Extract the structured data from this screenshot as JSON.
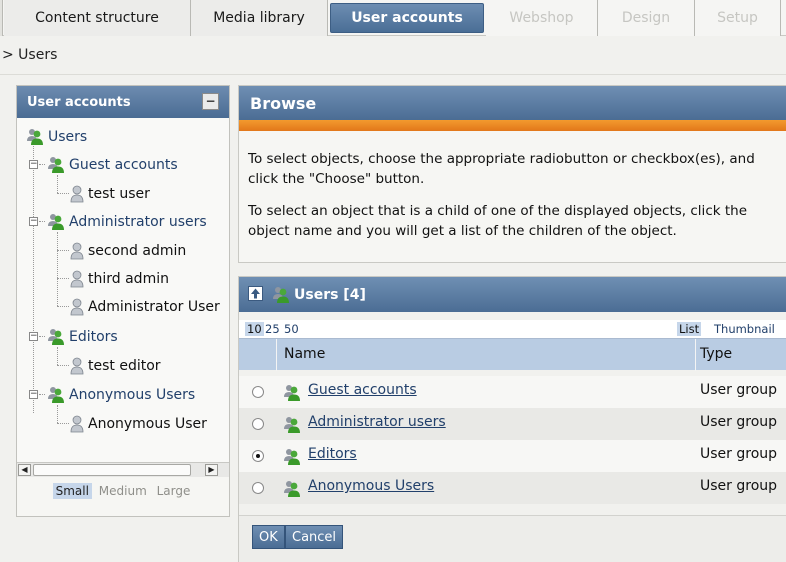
{
  "tabs": [
    {
      "label": "Content structure",
      "state": "normal"
    },
    {
      "label": "Media library",
      "state": "normal"
    },
    {
      "label": "User accounts",
      "state": "active"
    },
    {
      "label": "Webshop",
      "state": "disabled"
    },
    {
      "label": "Design",
      "state": "disabled"
    },
    {
      "label": "Setup",
      "state": "disabled"
    }
  ],
  "breadcrumb": "> Users",
  "left_panel": {
    "title": "User accounts",
    "minimize_label": "−",
    "tree": {
      "root": "Users",
      "guest_group": "Guest accounts",
      "test_user": "test user",
      "admin_group": "Administrator users",
      "second_admin": "second admin",
      "third_admin": "third admin",
      "administrator_user": "Administrator User",
      "editors_group": "Editors",
      "test_editor": "test editor",
      "anonymous_group": "Anonymous Users",
      "anonymous_user": "Anonymous User"
    },
    "sizes": {
      "small": "Small",
      "medium": "Medium",
      "large": "Large",
      "selected": "Small"
    }
  },
  "browse": {
    "title": "Browse",
    "paragraph1": "To select objects, choose the appropriate radiobutton or checkbox(es), and click the \"Choose\" button.",
    "paragraph2": "To select an object that is a child of one of the displayed objects, click the object name and you will get a list of the children of the object."
  },
  "users_list": {
    "title": "Users [4]",
    "pager": {
      "opt1": "10",
      "opt2": "25",
      "opt3": "50",
      "selected": "10"
    },
    "views": {
      "list": "List",
      "thumbnail": "Thumbnail",
      "selected": "List"
    },
    "columns": {
      "name": "Name",
      "type": "Type"
    },
    "rows": [
      {
        "name": "Guest accounts",
        "type": "User group",
        "selected": false
      },
      {
        "name": "Administrator users",
        "type": "User group",
        "selected": false
      },
      {
        "name": "Editors",
        "type": "User group",
        "selected": true
      },
      {
        "name": "Anonymous Users",
        "type": "User group",
        "selected": false
      }
    ],
    "ok_label": "OK",
    "cancel_label": "Cancel"
  },
  "colors": {
    "header_blue": "#4b6d94",
    "orange_bar": "#e2771a",
    "link": "#22406b",
    "group_icon_green": "#3a9a2a"
  },
  "icons": {
    "group": "user-group-icon",
    "user": "user-icon",
    "up": "parent-up-icon"
  }
}
